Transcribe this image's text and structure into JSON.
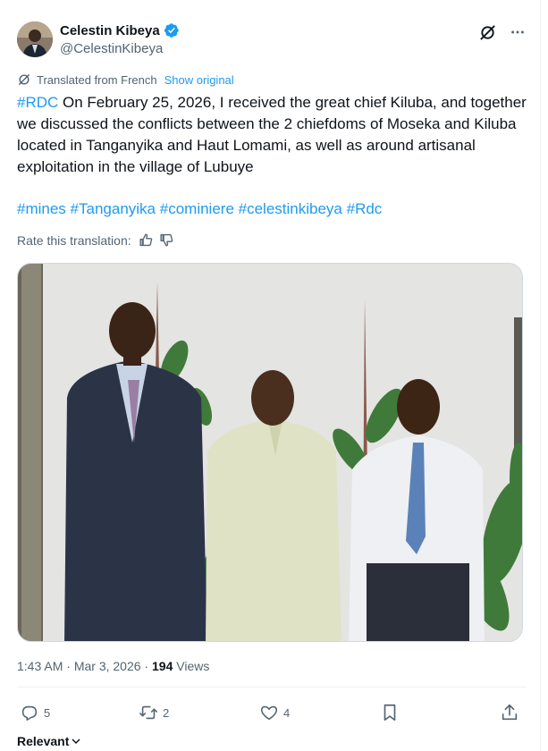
{
  "author": {
    "name": "Celestin Kibeya",
    "handle": "@CelestinKibeya"
  },
  "translation": {
    "label": "Translated from French",
    "show_original": "Show original"
  },
  "tweet": {
    "lead_hashtag": "#RDC",
    "text": " On February 25, 2026, I received the great chief Kiluba, and together we discussed the conflicts between the 2 chiefdoms of Moseka and Kiluba located in Tanganyika and Haut Lomami, as well as around artisanal exploitation in the village of Lubuye",
    "hashtags": [
      "#mines",
      "#Tanganyika",
      "#cominiere",
      "#celestinkibeya",
      "#Rdc"
    ]
  },
  "rate_translation": "Rate this translation:",
  "meta": {
    "time": "1:43 AM",
    "sep1": " · ",
    "date": "Mar 3, 2026",
    "sep2": " · ",
    "views_count": "194",
    "views_label": " Views"
  },
  "actions": {
    "replies": "5",
    "reposts": "2",
    "likes": "4"
  },
  "sort_label": "Relevant",
  "colors": {
    "accent": "#1d9bf0",
    "muted": "#536471",
    "text": "#0f1419"
  },
  "icons": [
    "verified-badge-icon",
    "grok-icon",
    "more-icon",
    "translate-icon",
    "thumbs-up-icon",
    "thumbs-down-icon",
    "reply-icon",
    "repost-icon",
    "like-icon",
    "bookmark-icon",
    "share-icon",
    "chevron-down-icon"
  ]
}
